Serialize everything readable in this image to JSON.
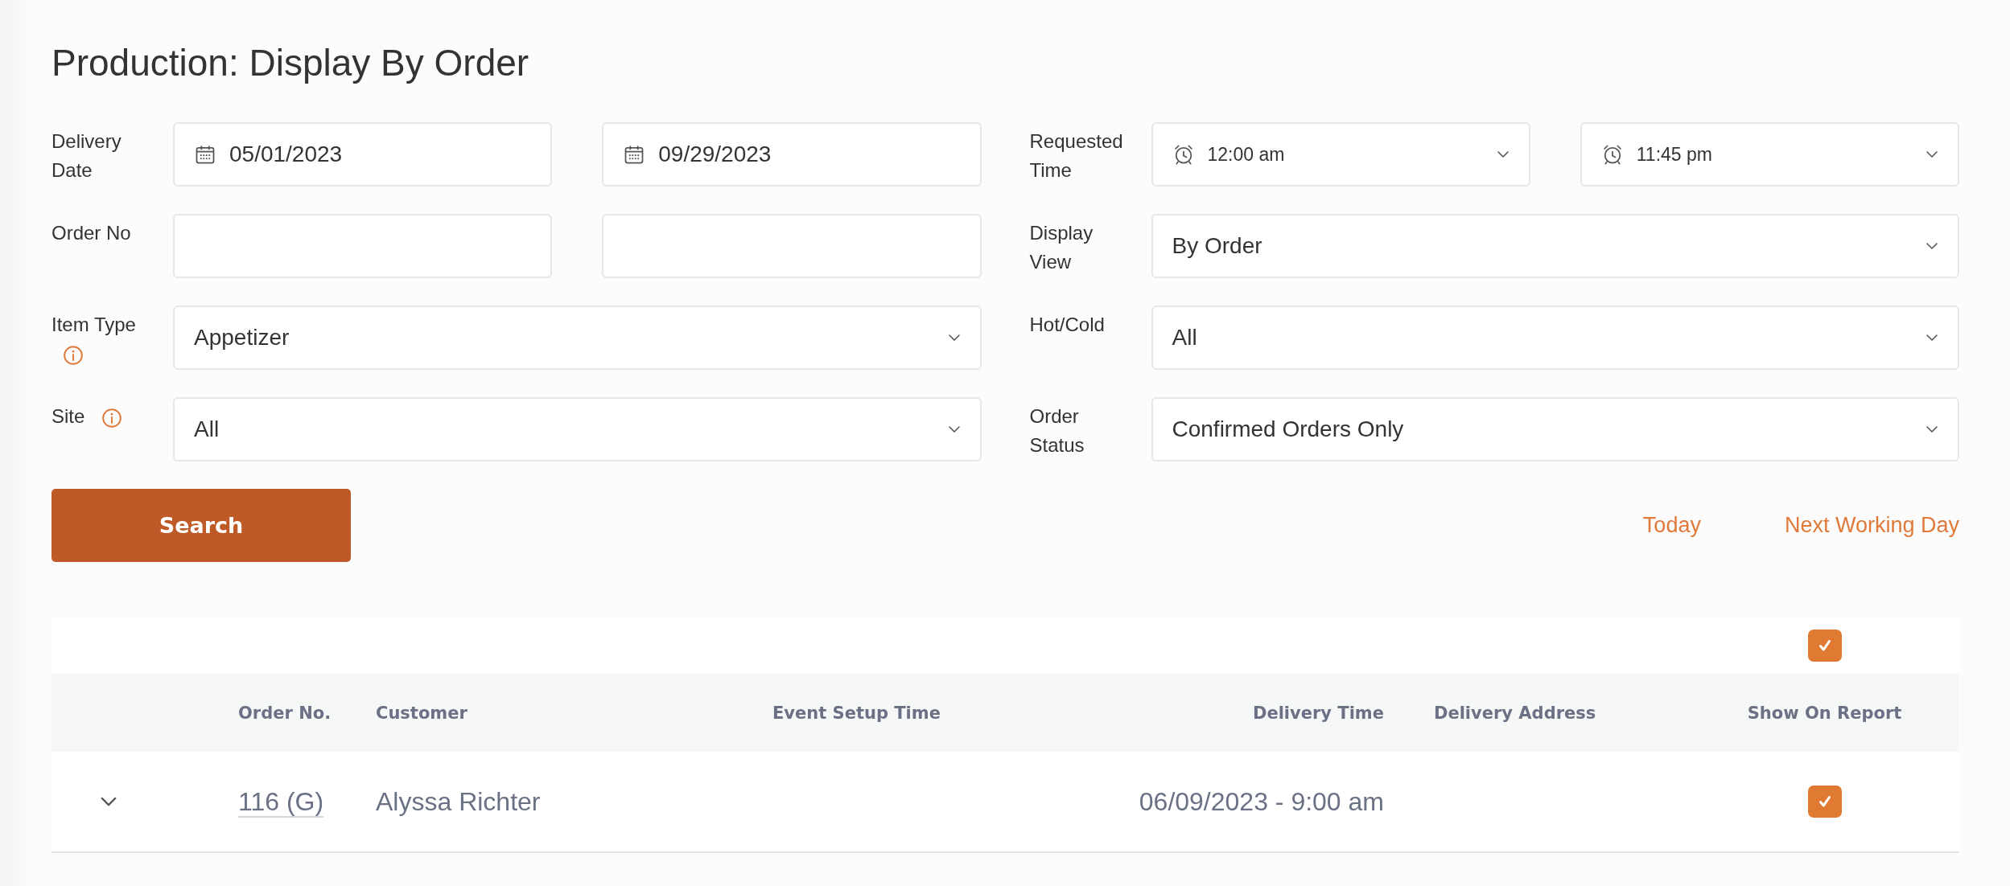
{
  "page": {
    "title": "Production: Display By Order"
  },
  "filters": [
    {
      "label": "Delivery Date",
      "info_icon": false,
      "fields": [
        {
          "kind": "date",
          "value": "05/01/2023"
        },
        {
          "kind": "date",
          "value": "09/29/2023"
        }
      ]
    },
    {
      "label": "Requested Time",
      "info_icon": false,
      "fields": [
        {
          "kind": "time",
          "value": "12:00 am"
        },
        {
          "kind": "time",
          "value": "11:45 pm"
        }
      ]
    },
    {
      "label": "Order No",
      "info_icon": false,
      "fields": [
        {
          "kind": "text"
        },
        {
          "kind": "text"
        }
      ]
    },
    {
      "label": "Display View",
      "info_icon": false,
      "fields": [
        {
          "kind": "select",
          "value": "By Order"
        }
      ]
    },
    {
      "label": "Item Type",
      "info_icon": true,
      "fields": [
        {
          "kind": "select",
          "value": "Appetizer"
        }
      ]
    },
    {
      "label": "Hot/Cold",
      "info_icon": false,
      "fields": [
        {
          "kind": "select",
          "value": "All"
        }
      ]
    },
    {
      "label": "Site",
      "info_icon": true,
      "fields": [
        {
          "kind": "select",
          "value": "All"
        }
      ]
    },
    {
      "label": "Order Status",
      "info_icon": false,
      "fields": [
        {
          "kind": "select",
          "value": "Confirmed Orders Only"
        }
      ]
    }
  ],
  "search_button": "Search",
  "quick_links": [
    "Today",
    "Next Working Day"
  ],
  "table": {
    "select_all_checked": true,
    "columns": [
      "Order No.",
      "Customer",
      "Event Setup Time",
      "Delivery Time",
      "Delivery Address",
      "Show On Report"
    ],
    "rows": [
      {
        "expanded": false,
        "order_no": "116 (G)",
        "customer": "Alyssa Richter",
        "delivery_time": "06/09/2023 - 9:00 am",
        "show_on_report": true
      }
    ]
  }
}
